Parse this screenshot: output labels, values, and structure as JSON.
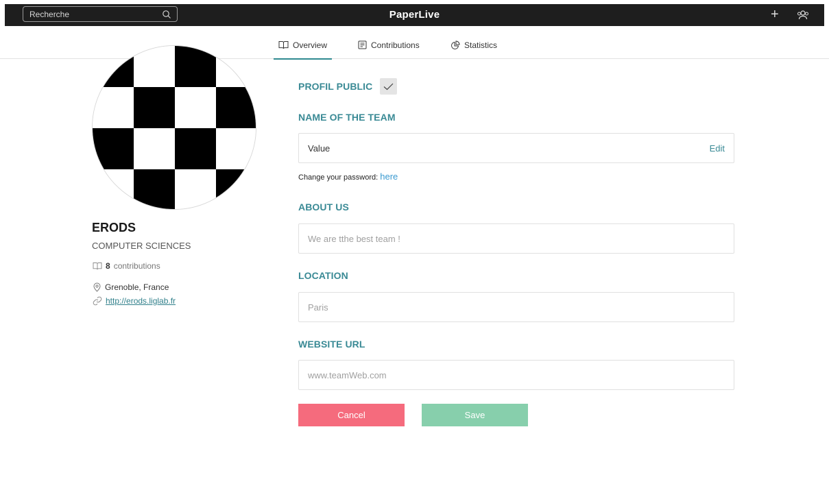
{
  "header": {
    "search_placeholder": "Recherche",
    "brand": "PaperLive",
    "add_glyph": "+",
    "icons": [
      "search-icon",
      "plus-icon",
      "users-icon"
    ]
  },
  "tabs": [
    {
      "label": "Overview",
      "icon": "book-icon",
      "active": true
    },
    {
      "label": "Contributions",
      "icon": "documents-icon",
      "active": false
    },
    {
      "label": "Statistics",
      "icon": "pie-chart-icon",
      "active": false
    }
  ],
  "profile": {
    "name": "ERODS",
    "department": "COMPUTER SCIENCES",
    "contributions_count": "8",
    "contributions_label": "contributions",
    "location": "Grenoble, France",
    "website": "http://erods.liglab.fr"
  },
  "form": {
    "public_label": "PROFIL PUBLIC",
    "public_checked": true,
    "team_name_label": "NAME OF THE TEAM",
    "team_name_value": "Value",
    "edit_label": "Edit",
    "password_text": "Change your password:",
    "password_link": "here",
    "about_label": "ABOUT US",
    "about_placeholder": "We are tthe best team !",
    "location_label": "LOCATION",
    "location_placeholder": "Paris",
    "website_label": "WEBSITE URL",
    "website_placeholder": "www.teamWeb.com",
    "cancel_label": "Cancel",
    "save_label": "Save"
  },
  "colors": {
    "topbar": "#1e1e1e",
    "accent": "#3a8a95",
    "cancel": "#f56b7d",
    "save": "#87cfac",
    "link": "#3a9ad0"
  }
}
